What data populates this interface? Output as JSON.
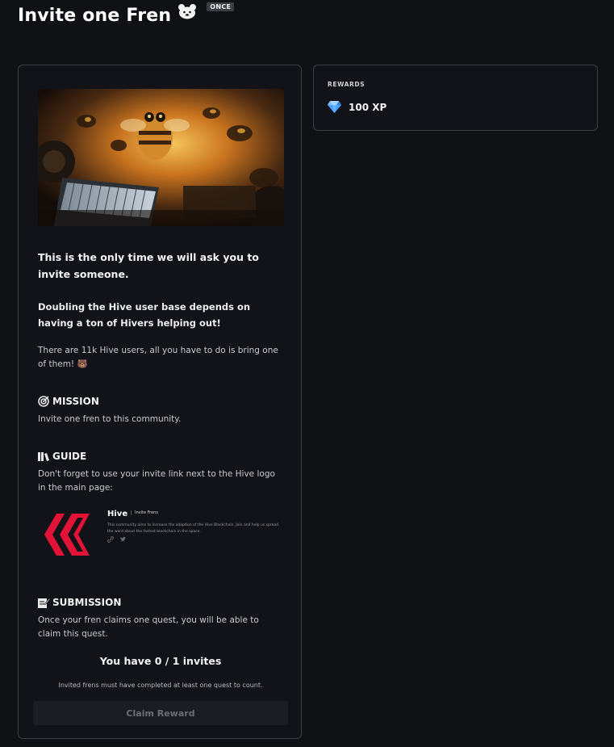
{
  "header": {
    "title": "Invite one Fren",
    "title_emoji": "fren-face-icon",
    "frequency_badge": "ONCE"
  },
  "quest": {
    "hero_image": "bees-machines-illustration",
    "intro_heading": "This is the only time we will ask you to invite someone.",
    "sub_heading": "Doubling the Hive user base depends on having a ton of Hivers helping out!",
    "body": "There are 11k Hive users, all you have to do is bring one of them! 🐻",
    "mission": {
      "heading": "MISSION",
      "icon": "target-icon",
      "text": "Invite one fren to this community."
    },
    "guide": {
      "heading": "GUIDE",
      "icon": "books-icon",
      "text": "Don't forget to use your invite link next to the Hive logo in the main page:",
      "preview": {
        "name": "Hive",
        "tag": "Invite Frens",
        "description": "This community aims to increase the adoption of the Hive Blockchain. Join and help us spread the word about the fastest blockchain in the space."
      }
    },
    "submission": {
      "heading": "SUBMISSION",
      "icon": "memo-icon",
      "text": "Once your fren claims one quest, you will be able to claim this quest."
    },
    "invites_status": "You have 0 / 1 invites",
    "invites_note": "Invited frens must have completed at least one quest to count.",
    "claim_button": "Claim Reward"
  },
  "rewards": {
    "label": "REWARDS",
    "items": [
      {
        "icon": "gem-icon",
        "value": "100 XP"
      }
    ]
  },
  "colors": {
    "background": "#0f1115",
    "card_border": "#3a3d44",
    "hive_red": "#e31337",
    "gem_blue": "#4aa3ff"
  }
}
